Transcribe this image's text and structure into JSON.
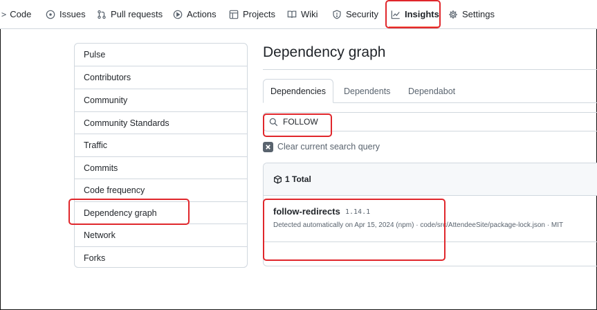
{
  "nav": {
    "prefix": "<> ",
    "items": [
      {
        "label": "Code",
        "icon": "code-icon"
      },
      {
        "label": "Issues",
        "icon": "issue-icon"
      },
      {
        "label": "Pull requests",
        "icon": "pull-request-icon"
      },
      {
        "label": "Actions",
        "icon": "play-icon"
      },
      {
        "label": "Projects",
        "icon": "table-icon"
      },
      {
        "label": "Wiki",
        "icon": "book-icon"
      },
      {
        "label": "Security",
        "icon": "shield-icon"
      },
      {
        "label": "Insights",
        "icon": "graph-icon",
        "active": true
      },
      {
        "label": "Settings",
        "icon": "gear-icon"
      }
    ]
  },
  "sidebar": {
    "items": [
      {
        "label": "Pulse"
      },
      {
        "label": "Contributors"
      },
      {
        "label": "Community"
      },
      {
        "label": "Community Standards"
      },
      {
        "label": "Traffic"
      },
      {
        "label": "Commits"
      },
      {
        "label": "Code frequency"
      },
      {
        "label": "Dependency graph",
        "active": true
      },
      {
        "label": "Network"
      },
      {
        "label": "Forks"
      }
    ]
  },
  "main": {
    "title": "Dependency graph",
    "tabs": [
      {
        "label": "Dependencies",
        "selected": true
      },
      {
        "label": "Dependents"
      },
      {
        "label": "Dependabot"
      }
    ],
    "search": {
      "value": "FOLLOW"
    },
    "clear_label": "Clear current search query",
    "total_label": "1 Total",
    "dependencies": [
      {
        "name": "follow-redirects",
        "version": "1.14.1",
        "meta": "Detected automatically on Apr 15, 2024 (npm) · code/src/AttendeeSite/package-lock.json · MIT"
      }
    ]
  },
  "colors": {
    "highlight": "#e0262b",
    "active_underline": "#fd8c73",
    "border": "#d0d7de",
    "muted_text": "#59636e"
  }
}
